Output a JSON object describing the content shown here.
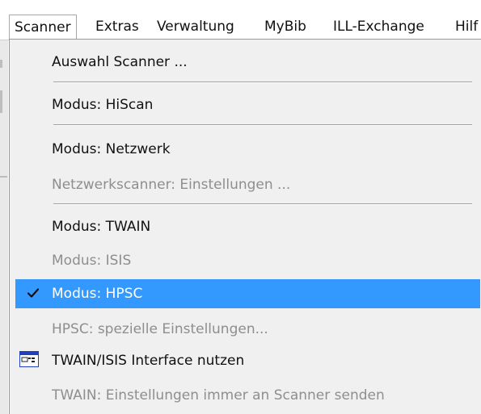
{
  "menubar": {
    "items": [
      {
        "label": "Scanner",
        "active": true
      },
      {
        "label": "Extras"
      },
      {
        "label": "Verwaltung"
      },
      {
        "label": "MyBib"
      },
      {
        "label": "ILL-Exchange"
      },
      {
        "label": "Hilf"
      }
    ]
  },
  "scanner_menu": {
    "items": [
      {
        "label": "Auswahl Scanner ...",
        "enabled": true
      },
      {
        "label": "Modus: HiScan",
        "enabled": true
      },
      {
        "label": "Modus: Netzwerk",
        "enabled": true
      },
      {
        "label": "Netzwerkscanner: Einstellungen ...",
        "enabled": false
      },
      {
        "label": "Modus: TWAIN",
        "enabled": true
      },
      {
        "label": "Modus: ISIS",
        "enabled": false
      },
      {
        "label": "Modus: HPSC",
        "enabled": true,
        "checked": true,
        "highlighted": true
      },
      {
        "label": "HPSC: spezielle Einstellungen...",
        "enabled": false
      },
      {
        "label": "TWAIN/ISIS Interface nutzen",
        "enabled": true,
        "icon": "window-interface-icon"
      },
      {
        "label": "TWAIN: Einstellungen immer an Scanner senden",
        "enabled": false
      }
    ]
  },
  "colors": {
    "highlight": "#3399ff",
    "menu_background": "#f0f0f0",
    "disabled_text": "#8e8e8e",
    "icon_blue": "#1f3fbf"
  }
}
